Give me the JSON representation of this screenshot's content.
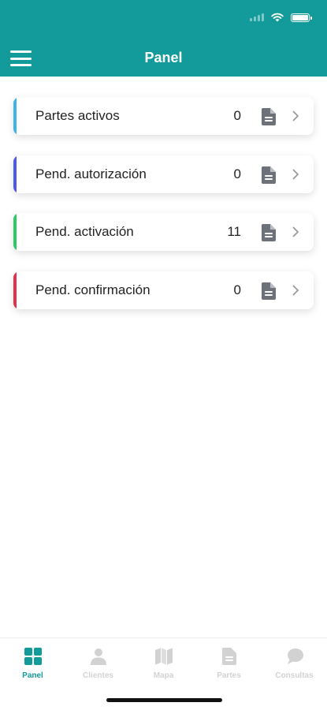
{
  "header": {
    "title": "Panel",
    "background": "#139b9b",
    "menu_icon": "hamburger-menu-icon"
  },
  "status_bar": {
    "icons": [
      "signal-icon",
      "wifi-icon",
      "battery-icon"
    ]
  },
  "cards": [
    {
      "label": "Partes activos",
      "count": "0",
      "accent": "#3fb2ea",
      "icon": "document-icon"
    },
    {
      "label": "Pend. autorización",
      "count": "0",
      "accent": "#4b5be6",
      "icon": "document-icon"
    },
    {
      "label": "Pend. activación",
      "count": "11",
      "accent": "#2ec866",
      "icon": "document-icon"
    },
    {
      "label": "Pend. confirmación",
      "count": "0",
      "accent": "#e0324b",
      "icon": "document-icon"
    }
  ],
  "tabbar": {
    "active_color": "#139b9b",
    "inactive_color": "#d2d2d2",
    "tabs": [
      {
        "label": "Panel",
        "icon": "grid-icon",
        "active": true
      },
      {
        "label": "Clientes",
        "icon": "person-icon",
        "active": false
      },
      {
        "label": "Mapa",
        "icon": "map-icon",
        "active": false
      },
      {
        "label": "Partes",
        "icon": "document-icon",
        "active": false
      },
      {
        "label": "Consultas",
        "icon": "chat-bubble-icon",
        "active": false
      }
    ]
  }
}
